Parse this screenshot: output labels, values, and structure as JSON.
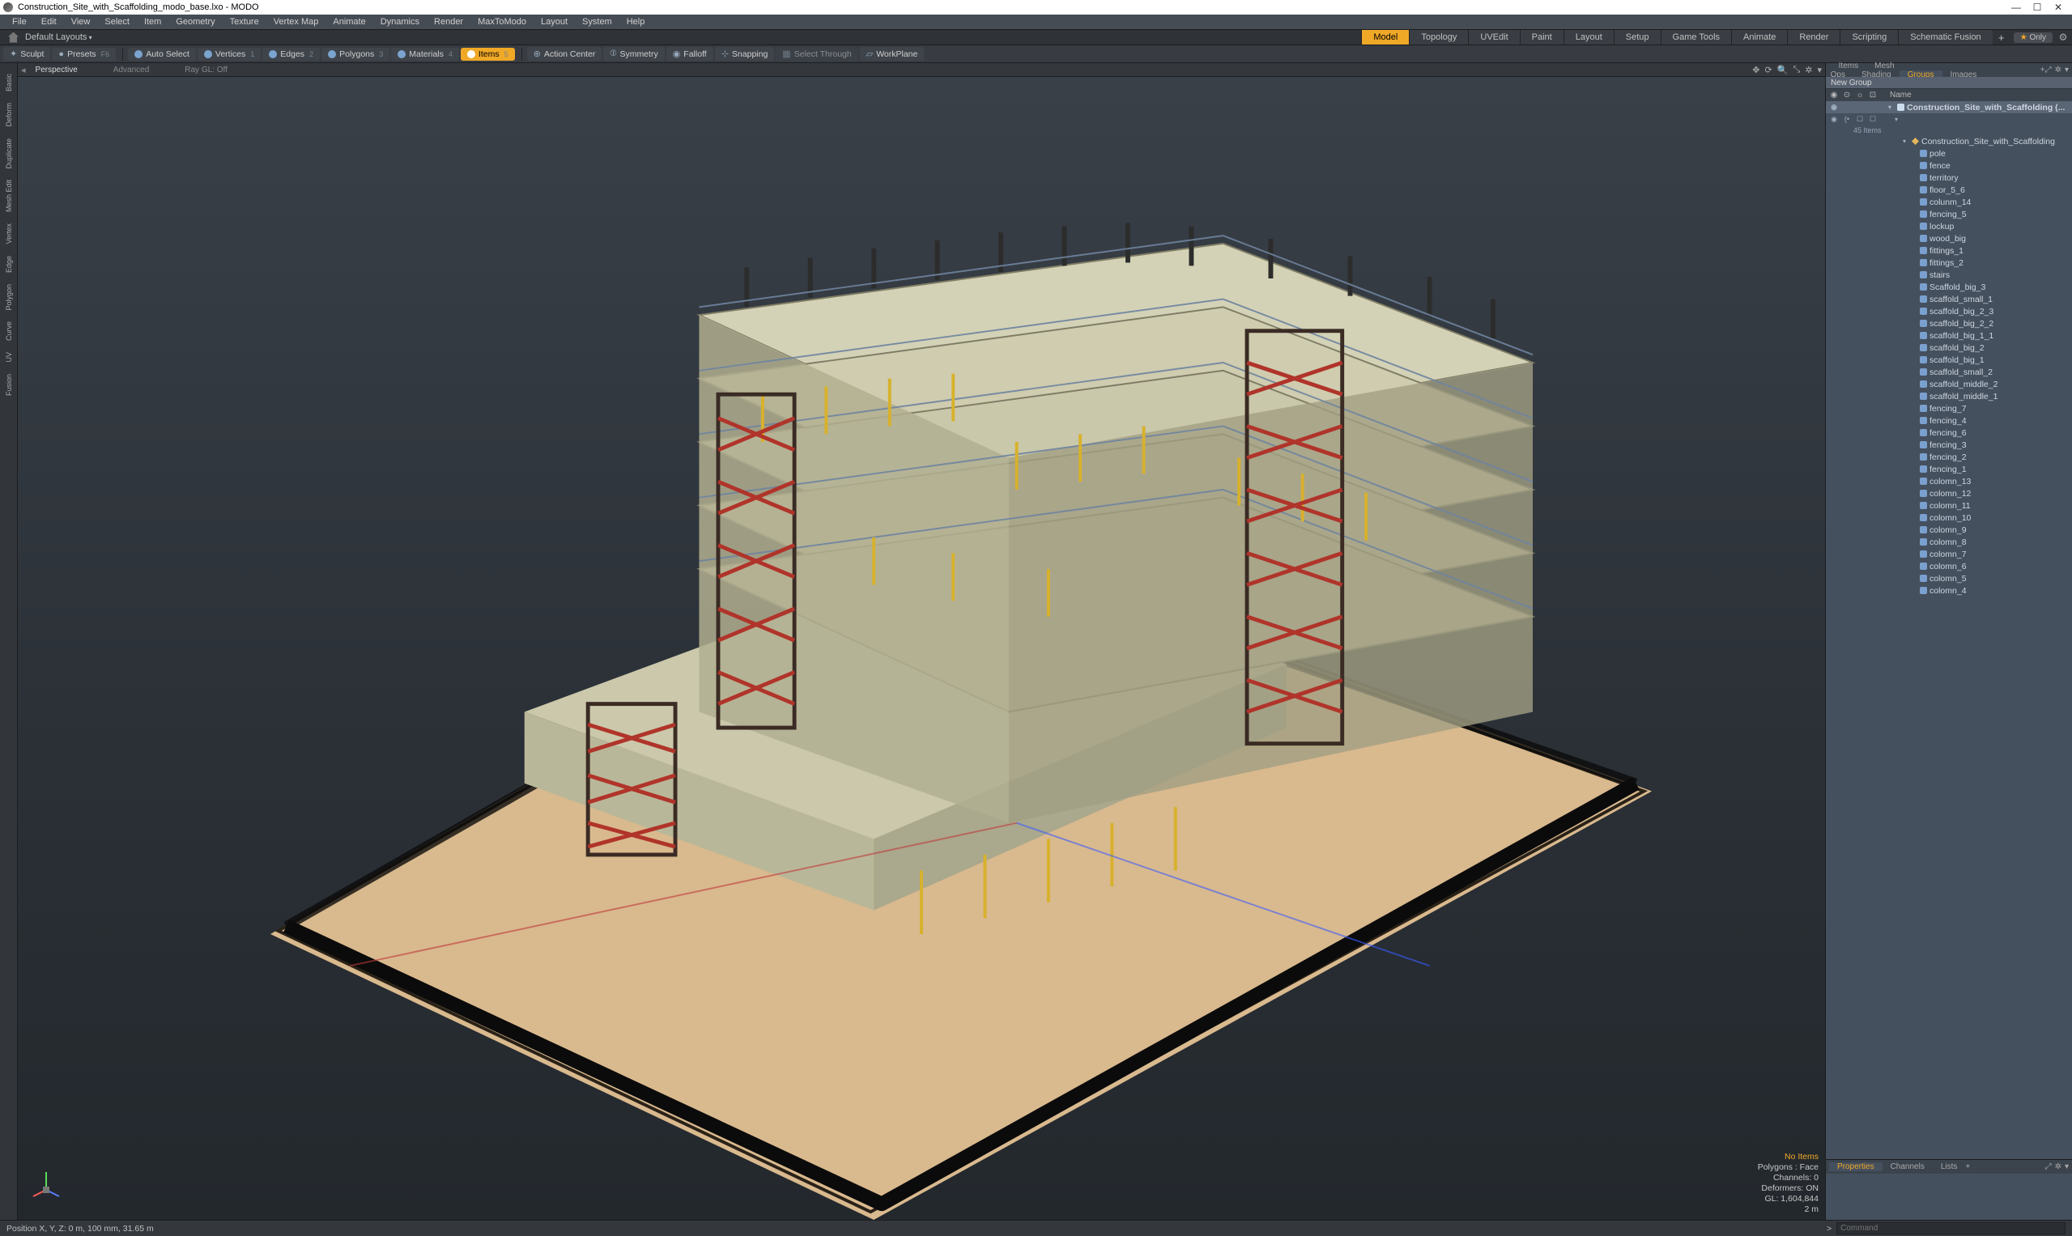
{
  "window": {
    "title": "Construction_Site_with_Scaffolding_modo_base.lxo - MODO"
  },
  "menu": [
    "File",
    "Edit",
    "View",
    "Select",
    "Item",
    "Geometry",
    "Texture",
    "Vertex Map",
    "Animate",
    "Dynamics",
    "Render",
    "MaxToModo",
    "Layout",
    "System",
    "Help"
  ],
  "layouts": {
    "home": "⌂",
    "label": "Default Layouts",
    "tabs": [
      "Model",
      "Topology",
      "UVEdit",
      "Paint",
      "Layout",
      "Setup",
      "Game Tools",
      "Animate",
      "Render",
      "Scripting",
      "Schematic Fusion"
    ],
    "active_tab": "Model",
    "only": "Only"
  },
  "toolbar": {
    "left": [
      {
        "label": "Sculpt",
        "icon": "✦"
      },
      {
        "label": "Presets",
        "icon": "●",
        "shortcut": "F6"
      }
    ],
    "selection": [
      {
        "label": "Auto Select",
        "shortcut": ""
      },
      {
        "label": "Vertices",
        "shortcut": "1"
      },
      {
        "label": "Edges",
        "shortcut": "2"
      },
      {
        "label": "Polygons",
        "shortcut": "3"
      },
      {
        "label": "Materials",
        "shortcut": "4"
      },
      {
        "label": "Items",
        "shortcut": "5",
        "active": true
      }
    ],
    "right": [
      {
        "label": "Action Center",
        "icon": "⊕"
      },
      {
        "label": "Symmetry",
        "icon": "⦶"
      },
      {
        "label": "Falloff",
        "icon": "◉"
      },
      {
        "label": "Snapping",
        "icon": "⊹"
      },
      {
        "label": "Select Through",
        "icon": "▦",
        "dim": true
      },
      {
        "label": "WorkPlane",
        "icon": "▱"
      }
    ]
  },
  "side_tools": [
    "Basic",
    "Deform",
    "Duplicate",
    "Mesh Edit",
    "Vertex",
    "Edge",
    "Polygon",
    "Curve",
    "UV",
    "Fusion"
  ],
  "viewport": {
    "tabs_left": [
      "Perspective",
      "Advanced",
      "Ray GL: Off"
    ],
    "controls": [
      "✥",
      "⟳",
      "🔍",
      "⤡",
      "✲",
      "▾"
    ]
  },
  "stats": {
    "no_items": "No Items",
    "polygons": "Polygons : Face",
    "channels": "Channels: 0",
    "deformers": "Deformers: ON",
    "gl": "GL: 1,604,844",
    "dist": "2 m"
  },
  "right_panel": {
    "tabs": [
      "Items",
      "Mesh Ops",
      "Shading",
      "Groups",
      "Images"
    ],
    "active": "Groups",
    "new_group": "New Group",
    "header_cols": {
      "name": "Name"
    },
    "root": {
      "label": "Construction_Site_with_Scaffolding (...",
      "count": "45 Items"
    },
    "items": [
      {
        "label": "Construction_Site_with_Scaffolding",
        "type": "locator",
        "indent": 2
      },
      {
        "label": "pole",
        "type": "mesh",
        "indent": 3
      },
      {
        "label": "fence",
        "type": "mesh",
        "indent": 3
      },
      {
        "label": "territory",
        "type": "mesh",
        "indent": 3
      },
      {
        "label": "floor_5_6",
        "type": "mesh",
        "indent": 3
      },
      {
        "label": "colunm_14",
        "type": "mesh",
        "indent": 3
      },
      {
        "label": "fencing_5",
        "type": "mesh",
        "indent": 3
      },
      {
        "label": "lockup",
        "type": "mesh",
        "indent": 3
      },
      {
        "label": "wood_big",
        "type": "mesh",
        "indent": 3
      },
      {
        "label": "fittings_1",
        "type": "mesh",
        "indent": 3
      },
      {
        "label": "fittings_2",
        "type": "mesh",
        "indent": 3
      },
      {
        "label": "stairs",
        "type": "mesh",
        "indent": 3
      },
      {
        "label": "Scaffold_big_3",
        "type": "mesh",
        "indent": 3
      },
      {
        "label": "scaffold_small_1",
        "type": "mesh",
        "indent": 3
      },
      {
        "label": "scaffold_big_2_3",
        "type": "mesh",
        "indent": 3
      },
      {
        "label": "scaffold_big_2_2",
        "type": "mesh",
        "indent": 3
      },
      {
        "label": "scaffold_big_1_1",
        "type": "mesh",
        "indent": 3
      },
      {
        "label": "scaffold_big_2",
        "type": "mesh",
        "indent": 3
      },
      {
        "label": "scaffold_big_1",
        "type": "mesh",
        "indent": 3
      },
      {
        "label": "scaffold_small_2",
        "type": "mesh",
        "indent": 3
      },
      {
        "label": "scaffold_middle_2",
        "type": "mesh",
        "indent": 3
      },
      {
        "label": "scaffold_middle_1",
        "type": "mesh",
        "indent": 3
      },
      {
        "label": "fencing_7",
        "type": "mesh",
        "indent": 3
      },
      {
        "label": "fencing_4",
        "type": "mesh",
        "indent": 3
      },
      {
        "label": "fencing_6",
        "type": "mesh",
        "indent": 3
      },
      {
        "label": "fencing_3",
        "type": "mesh",
        "indent": 3
      },
      {
        "label": "fencing_2",
        "type": "mesh",
        "indent": 3
      },
      {
        "label": "fencing_1",
        "type": "mesh",
        "indent": 3
      },
      {
        "label": "colomn_13",
        "type": "mesh",
        "indent": 3
      },
      {
        "label": "colomn_12",
        "type": "mesh",
        "indent": 3
      },
      {
        "label": "colomn_11",
        "type": "mesh",
        "indent": 3
      },
      {
        "label": "colomn_10",
        "type": "mesh",
        "indent": 3
      },
      {
        "label": "colomn_9",
        "type": "mesh",
        "indent": 3
      },
      {
        "label": "colomn_8",
        "type": "mesh",
        "indent": 3
      },
      {
        "label": "colomn_7",
        "type": "mesh",
        "indent": 3
      },
      {
        "label": "colomn_6",
        "type": "mesh",
        "indent": 3
      },
      {
        "label": "colomn_5",
        "type": "mesh",
        "indent": 3
      },
      {
        "label": "colomn_4",
        "type": "mesh",
        "indent": 3
      }
    ]
  },
  "props_panel": {
    "tabs": [
      "Properties",
      "Channels",
      "Lists"
    ],
    "active": "Properties"
  },
  "statusbar": {
    "pos": "Position X, Y, Z:  0 m, 100 mm, 31.65 m",
    "cmd_prompt": ">",
    "cmd_placeholder": "Command"
  }
}
